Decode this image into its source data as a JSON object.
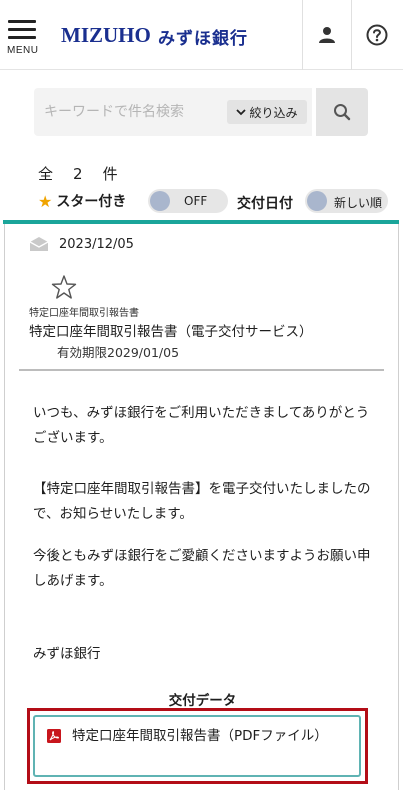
{
  "header": {
    "menu_label": "MENU",
    "logo_en": "MIZUHO",
    "logo_jp": "みずほ銀行",
    "icons": [
      "menu-icon",
      "user-icon",
      "help-icon"
    ]
  },
  "search": {
    "placeholder": "キーワードで件名検索",
    "filter_label": "絞り込み",
    "icon": "search-icon"
  },
  "list": {
    "count_prefix": "全",
    "count_value": "2",
    "count_suffix": "件",
    "starred_label": "スター付き",
    "starred_toggle": "OFF",
    "date_label": "交付日付",
    "date_toggle": "新しい順"
  },
  "message": {
    "date": "2023/12/05",
    "category": "特定口座年間取引報告書",
    "title": "特定口座年間取引報告書（電子交付サービス）",
    "expiry": "有効期限2029/01/05",
    "paragraphs": [
      "いつも、みずほ銀行をご利用いただきましてありがとうございます。",
      "【特定口座年間取引報告書】を電子交付いたしましたので、お知らせいたします。",
      "今後ともみずほ銀行をご愛顧くださいますようお願い申しあげます。",
      "みずほ銀行"
    ],
    "delivery_heading": "交付データ",
    "pdf_link": "特定口座年間取引報告書（PDFファイル）"
  },
  "colors": {
    "brand": "#1a2f8f",
    "accent_line": "#1aa59a",
    "highlight_frame": "#b30d17",
    "star": "#f0a400",
    "pdf_icon": "#c8161d"
  }
}
